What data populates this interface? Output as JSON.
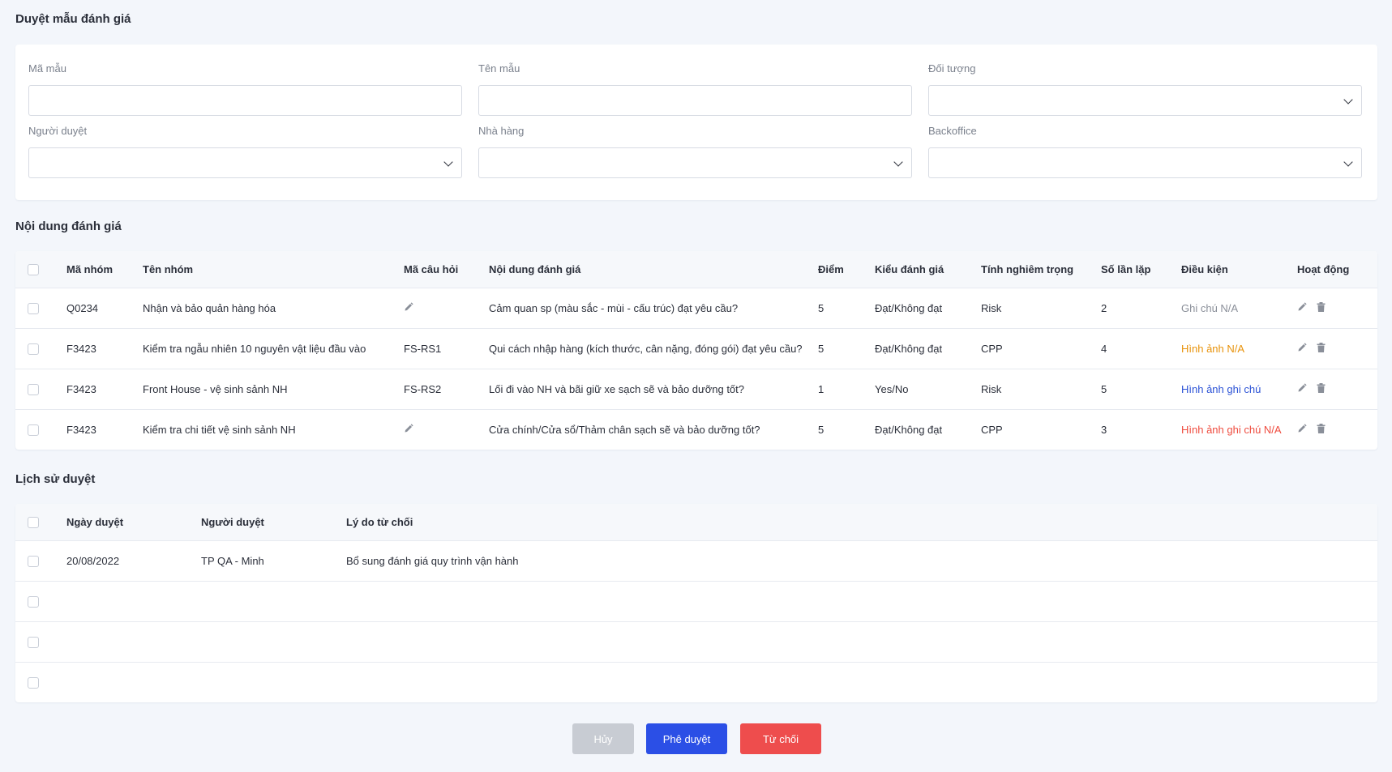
{
  "page_title": "Duyệt mẫu đánh giá",
  "filters": {
    "template_code": {
      "label": "Mã mẫu",
      "value": "",
      "placeholder": ""
    },
    "template_name": {
      "label": "Tên mẫu",
      "value": "",
      "placeholder": ""
    },
    "target": {
      "label": "Đối tượng",
      "value": ""
    },
    "approver": {
      "label": "Người duyệt",
      "value": ""
    },
    "restaurant": {
      "label": "Nhà hàng",
      "value": ""
    },
    "backoffice": {
      "label": "Backoffice",
      "value": ""
    }
  },
  "content_section": {
    "title": "Nội dung đánh giá",
    "columns": [
      "Mã nhóm",
      "Tên nhóm",
      "Mã câu hỏi",
      "Nội dung đánh giá",
      "Điểm",
      "Kiểu đánh giá",
      "Tính nghiêm trọng",
      "Số lần lặp",
      "Điều kiện",
      "Hoạt động"
    ],
    "rows": [
      {
        "group_code": "Q0234",
        "group_name": "Nhận và bảo quản hàng hóa",
        "question_code": "",
        "content": "Cảm quan sp (màu sắc - mùi - cấu trúc) đạt yêu cầu?",
        "score": "5",
        "eval_type": "Đạt/Không đạt",
        "severity": "Risk",
        "repeat": "2",
        "condition": "Ghi chú N/A",
        "condition_color": "gray"
      },
      {
        "group_code": "F3423",
        "group_name": "Kiểm tra ngẫu nhiên 10 nguyên vật liệu đầu vào",
        "question_code": "FS-RS1",
        "content": "Qui cách nhập hàng (kích thước, cân nặng, đóng gói) đạt yêu cầu?",
        "score": "5",
        "eval_type": "Đạt/Không đạt",
        "severity": "CPP",
        "repeat": "4",
        "condition": "Hình ảnh N/A",
        "condition_color": "orange"
      },
      {
        "group_code": "F3423",
        "group_name": "Front House - vệ sinh sảnh NH",
        "question_code": "FS-RS2",
        "content": "Lối đi vào NH và bãi giữ xe sạch sẽ và bảo dưỡng tốt?",
        "score": "1",
        "eval_type": "Yes/No",
        "severity": "Risk",
        "repeat": "5",
        "condition": "Hình ảnh ghi chú",
        "condition_color": "blue"
      },
      {
        "group_code": "F3423",
        "group_name": "Kiểm tra chi tiết vệ sinh sảnh NH",
        "question_code": "",
        "content": "Cửa chính/Cửa sổ/Thảm chân sạch sẽ và bảo dưỡng tốt?",
        "score": "5",
        "eval_type": "Đạt/Không đạt",
        "severity": "CPP",
        "repeat": "3",
        "condition": "Hình ảnh ghi chú N/A",
        "condition_color": "red"
      }
    ]
  },
  "history_section": {
    "title": "Lịch sử duyệt",
    "columns": [
      "Ngày duyệt",
      "Người duyệt",
      "Lý do từ chối"
    ],
    "rows": [
      {
        "date": "20/08/2022",
        "approver": "TP QA - Minh",
        "reason": "Bổ sung đánh giá quy trình vận hành"
      },
      {
        "date": "",
        "approver": "",
        "reason": ""
      },
      {
        "date": "",
        "approver": "",
        "reason": ""
      },
      {
        "date": "",
        "approver": "",
        "reason": ""
      }
    ]
  },
  "actions": {
    "cancel_label": "Hủy",
    "approve_label": "Phê duyệt",
    "reject_label": "Từ chối"
  },
  "colors": {
    "approve": "#2b4fe6",
    "reject": "#ee4d4d",
    "cancel": "#c8ccd3",
    "cond_gray": "#8a8f99",
    "cond_orange": "#e8930c",
    "cond_blue": "#2b52d6",
    "cond_red": "#ef4c3f"
  },
  "icons": {
    "question_edit": "pencil-icon",
    "row_edit": "pencil-icon",
    "row_delete": "trash-icon",
    "dropdown": "chevron-down-icon"
  }
}
